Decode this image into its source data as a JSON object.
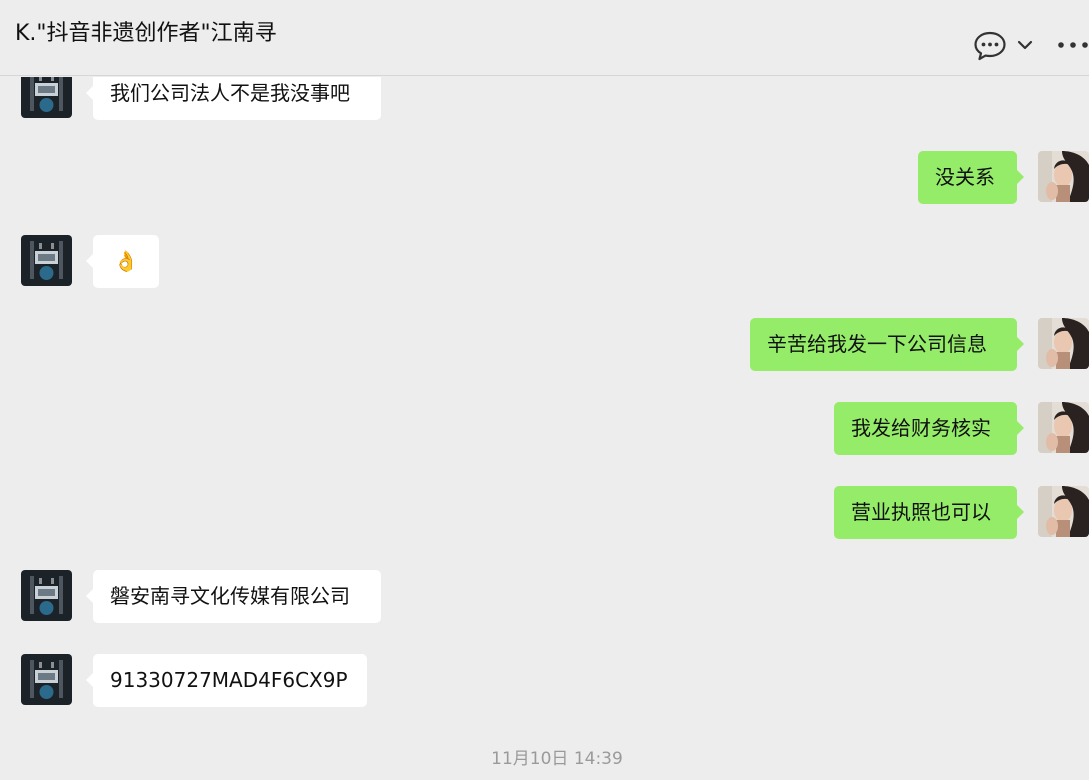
{
  "header": {
    "title": "K.\"抖音非遗创作者\"江南寻"
  },
  "messages": [
    {
      "side": "left",
      "text": "我们公司法人不是我没事吧"
    },
    {
      "side": "right",
      "text": "没关系"
    },
    {
      "side": "left",
      "text": "👌"
    },
    {
      "side": "right",
      "text": "辛苦给我发一下公司信息"
    },
    {
      "side": "right",
      "text": "我发给财务核实"
    },
    {
      "side": "right",
      "text": "营业执照也可以"
    },
    {
      "side": "left",
      "text": "磐安南寻文化传媒有限公司"
    },
    {
      "side": "left",
      "text": "91330727MAD4F6CX9P"
    }
  ],
  "timestamp": "11月10日 14:39",
  "icons": {
    "chat_info": "speech-bubble-icon",
    "dropdown": "chevron-down-icon",
    "more": "more-dots-icon"
  },
  "colors": {
    "background": "#ededed",
    "bubble_self": "#95ec69",
    "bubble_other": "#ffffff",
    "timestamp": "#9a9a9a"
  }
}
